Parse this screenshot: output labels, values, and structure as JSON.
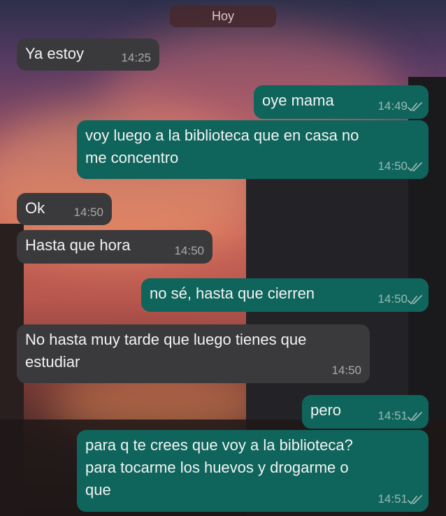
{
  "day_label": "Hoy",
  "messages": [
    {
      "direction": "in",
      "text": "Ya estoy",
      "time": "14:25"
    },
    {
      "direction": "out",
      "text": "oye mama",
      "time": "14:49",
      "status": "read"
    },
    {
      "direction": "out",
      "text": "voy luego a la biblioteca que en casa no\nme concentro",
      "time": "14:50",
      "status": "read"
    },
    {
      "direction": "in",
      "text": "Ok",
      "time": "14:50"
    },
    {
      "direction": "in",
      "text": "Hasta que hora",
      "time": "14:50"
    },
    {
      "direction": "out",
      "text": "no sé, hasta que cierren",
      "time": "14:50",
      "status": "read"
    },
    {
      "direction": "in",
      "text": "No hasta muy tarde que luego tienes que\nestudiar",
      "time": "14:50"
    },
    {
      "direction": "out",
      "text": "pero",
      "time": "14:51",
      "status": "read"
    },
    {
      "direction": "out",
      "text": "para q te crees que voy a la biblioteca?\npara tocarme los huevos y drogarme o\nque",
      "time": "14:51",
      "status": "read"
    }
  ],
  "colors": {
    "incoming_bubble": "#3a3a3c",
    "outgoing_bubble": "#0f655c",
    "day_chip": "#46282d"
  },
  "icons": {
    "read_receipt": "double-check-icon"
  }
}
